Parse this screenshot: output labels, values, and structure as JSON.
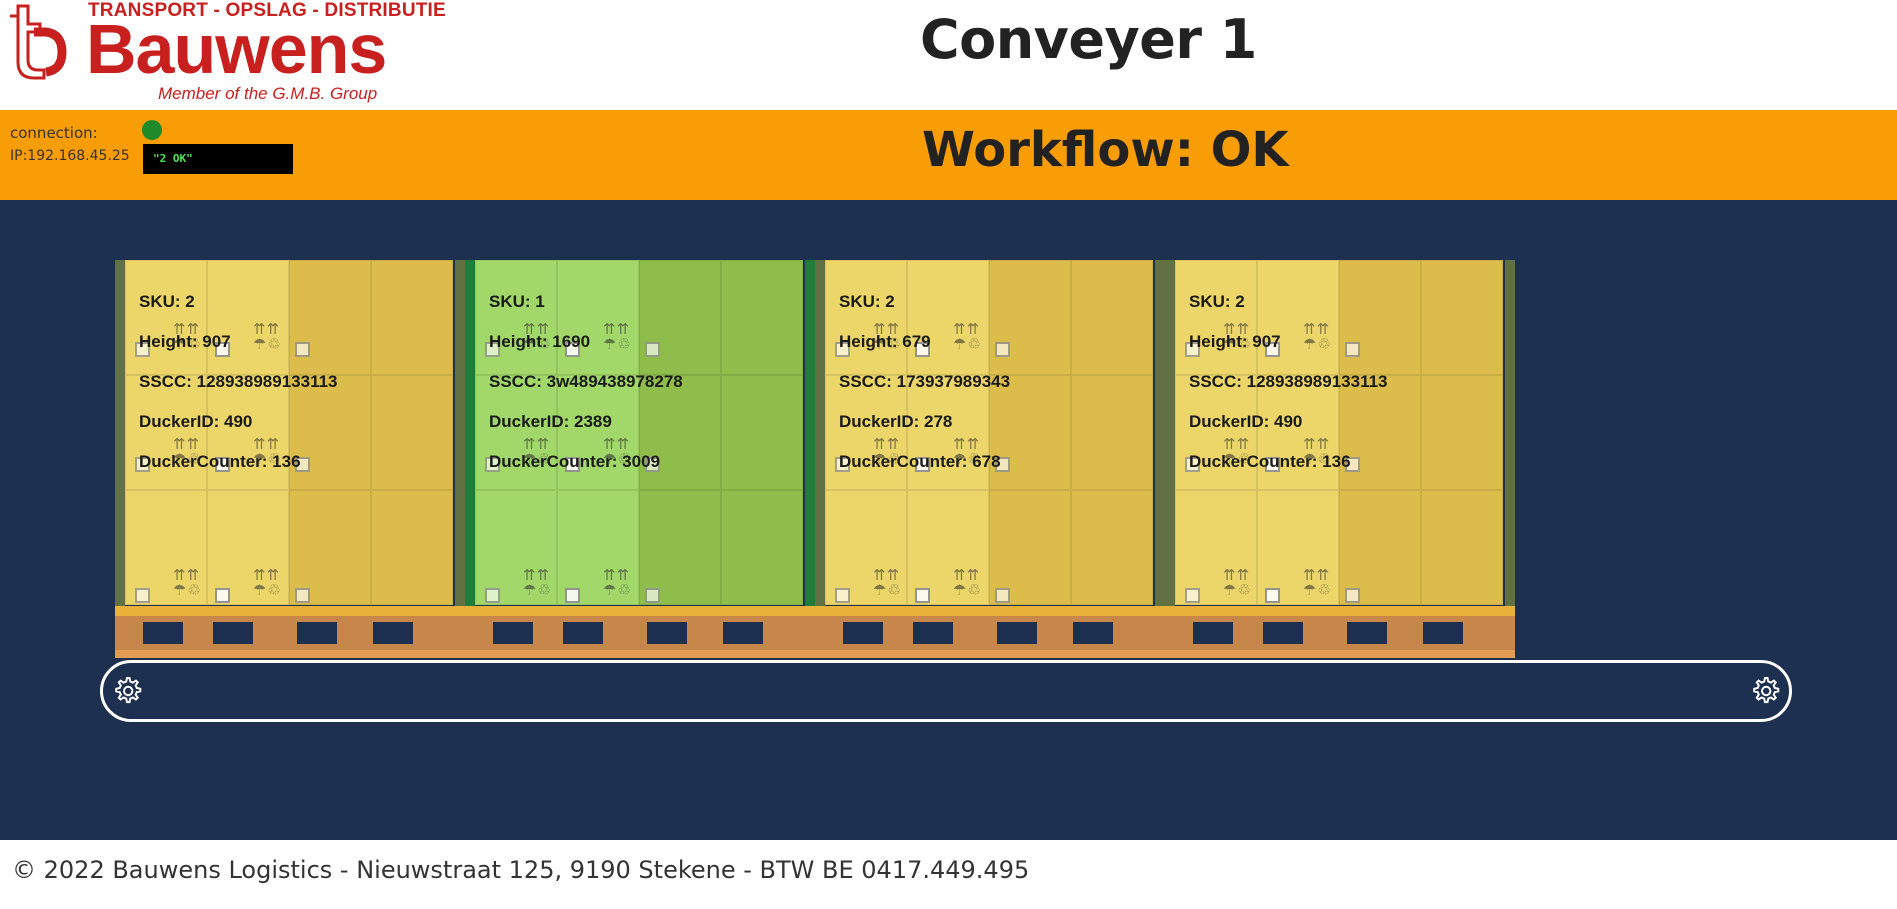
{
  "header": {
    "logo_top": "TRANSPORT - OPSLAG - DISTRIBUTIE",
    "logo_name": "Bauwens",
    "logo_tagline": "Member of the G.M.B. Group",
    "title": "Conveyer 1"
  },
  "status": {
    "connection_label": "connection:",
    "ip_label": "IP:192.168.45.25",
    "connection_color": "#1e8a2a",
    "terminal_text": "\"2 OK\"",
    "workflow": "Workflow: OK",
    "bar_color": "#f99d07"
  },
  "pallets": [
    {
      "sku": "SKU: 2",
      "height": "Height: 907",
      "sscc": "SSCC: 128938989133113",
      "ducker_id": "DuckerID: 490",
      "ducker_counter": "DuckerCounter: 136",
      "color": "yellow"
    },
    {
      "sku": "SKU: 1",
      "height": "Height: 1690",
      "sscc": "SSCC: 3w489438978278",
      "ducker_id": "DuckerID: 2389",
      "ducker_counter": "DuckerCounter: 3009",
      "color": "green"
    },
    {
      "sku": "SKU: 2",
      "height": "Height: 679",
      "sscc": "SSCC: 173937989343",
      "ducker_id": "DuckerID: 278",
      "ducker_counter": "DuckerCounter: 678",
      "color": "yellow"
    },
    {
      "sku": "SKU: 2",
      "height": "Height: 907",
      "sscc": "SSCC: 128938989133113",
      "ducker_id": "DuckerID: 490",
      "ducker_counter": "DuckerCounter: 136",
      "color": "yellow"
    }
  ],
  "belt": {
    "left_icon": "gear-icon",
    "right_icon": "gear-icon"
  },
  "footer": {
    "text": "© 2022 Bauwens Logistics - Nieuwstraat 125, 9190 Stekene - BTW BE 0417.449.495"
  },
  "colors": {
    "background": "#1d3050",
    "yellow": "#ecd66a",
    "green": "#a2d86a",
    "brand": "#c8201f"
  }
}
